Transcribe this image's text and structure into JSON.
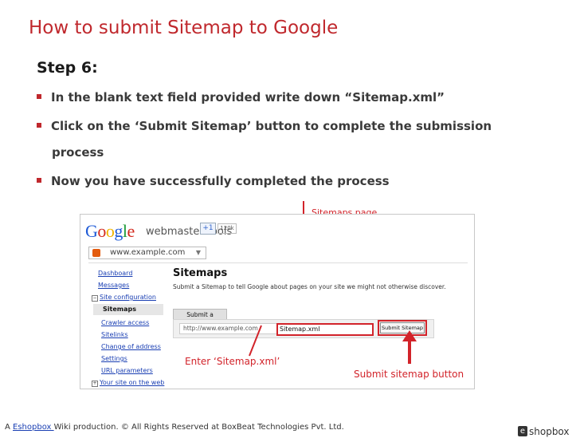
{
  "slide": {
    "title": "How to submit Sitemap to Google",
    "step": "Step 6:",
    "bullets": [
      "In the blank text field provided write down “Sitemap.xml”",
      "Click on the ‘Submit Sitemap’ button to complete the submission",
      "process",
      "Now you have successfully completed the process"
    ]
  },
  "annotations": {
    "sitemaps_page": "Sitemaps page",
    "enter": "Enter ‘Sitemap.xml’",
    "submit": "Submit  sitemap button"
  },
  "screenshot": {
    "google_letters": [
      "G",
      "o",
      "o",
      "g",
      "l",
      "e"
    ],
    "google_colors": [
      "#1f5bd6",
      "#d3281b",
      "#f0b400",
      "#1f5bd6",
      "#1e9b3a",
      "#d3281b"
    ],
    "webmaster": "webmaster tools",
    "plus_one": "+1",
    "plus_count": "120k",
    "site": "www.example.com",
    "nav": {
      "dashboard": "Dashboard",
      "messages": "Messages",
      "site_config": "Site configuration",
      "sitemaps": "Sitemaps",
      "crawler": "Crawler access",
      "sitelinks": "Sitelinks",
      "change": "Change of address",
      "settings": "Settings",
      "url_params": "URL parameters",
      "your_site": "Your site on the web"
    },
    "heading": "Sitemaps",
    "description": "Submit a Sitemap to tell Google about pages on your site we might not otherwise discover.",
    "tab": "Submit a Sitemap",
    "url_prefix": "http://www.example.com",
    "field_value": "Sitemap.xml",
    "submit_label": "Submit Sitemap"
  },
  "footer": {
    "prefix": "A ",
    "link": "Eshopbox ",
    "rest": "Wiki production. © All Rights Reserved at BoxBeat Technologies Pvt. Ltd."
  },
  "logo": {
    "e": "e",
    "word": "shopbox"
  }
}
